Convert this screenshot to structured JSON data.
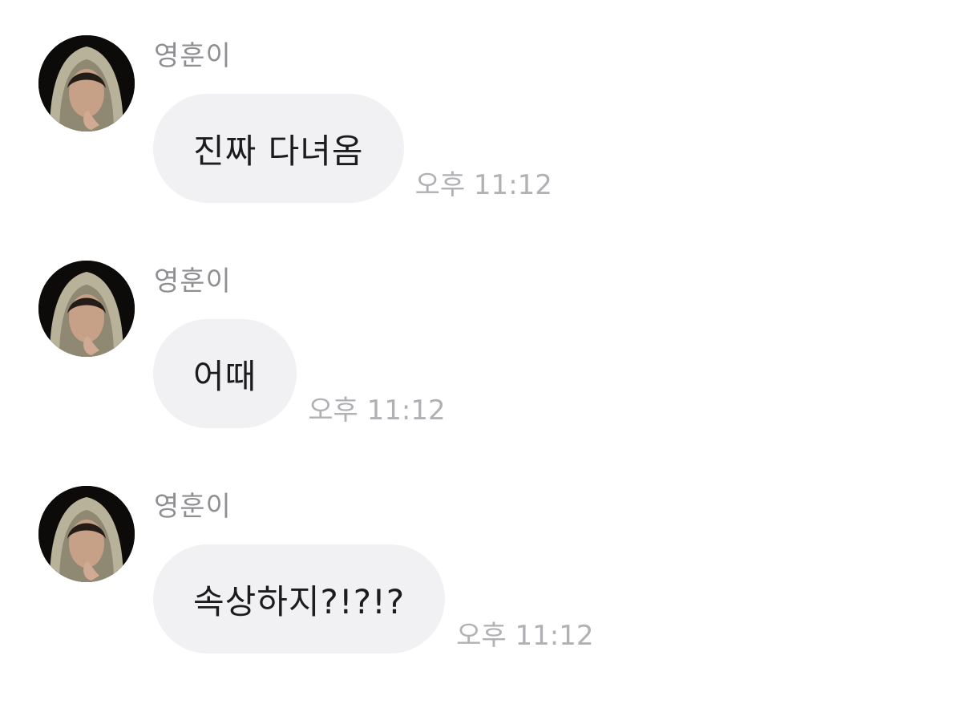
{
  "messages": [
    {
      "sender": "영훈이",
      "text": "진짜 다녀옴",
      "time": "오후 11:12",
      "avatar_icon": "profile-photo"
    },
    {
      "sender": "영훈이",
      "text": "어때",
      "time": "오후 11:12",
      "avatar_icon": "profile-photo"
    },
    {
      "sender": "영훈이",
      "text": "속상하지?!?!?",
      "time": "오후 11:12",
      "avatar_icon": "profile-photo"
    }
  ],
  "colors": {
    "bubble": "#f1f1f3",
    "sender": "#8e8e93",
    "time": "#b0b0b5",
    "text": "#1c1c1e"
  }
}
